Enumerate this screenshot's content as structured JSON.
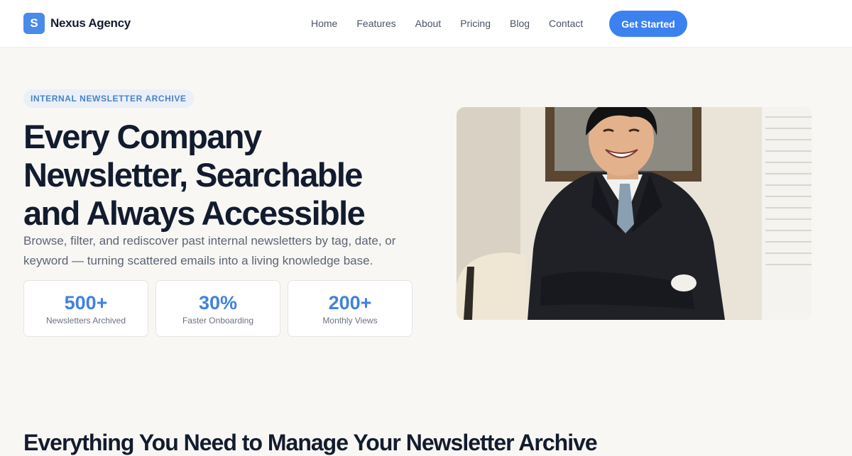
{
  "brand": {
    "logo_letter": "S",
    "name": "Nexus Agency",
    "accent": "#3b82f0"
  },
  "nav": {
    "links": [
      "Home",
      "Features",
      "About",
      "Pricing",
      "Blog",
      "Contact"
    ],
    "cta": "Get Started"
  },
  "hero": {
    "eyebrow": "INTERNAL NEWSLETTER ARCHIVE",
    "headline": "Every Company Newsletter, Searchable and Always Accessible",
    "subtitle": "Browse, filter, and rediscover past internal newsletters by tag, date, or keyword — turning scattered emails into a living knowledge base.",
    "stats": [
      {
        "value": "500+",
        "label": "Newsletters Archived"
      },
      {
        "value": "30%",
        "label": "Faster Onboarding"
      },
      {
        "value": "200+",
        "label": "Monthly Views"
      }
    ],
    "image_alt": "smiling-person-in-suit-photo"
  },
  "features": {
    "title": "Everything You Need to Manage Your Newsletter Archive"
  }
}
